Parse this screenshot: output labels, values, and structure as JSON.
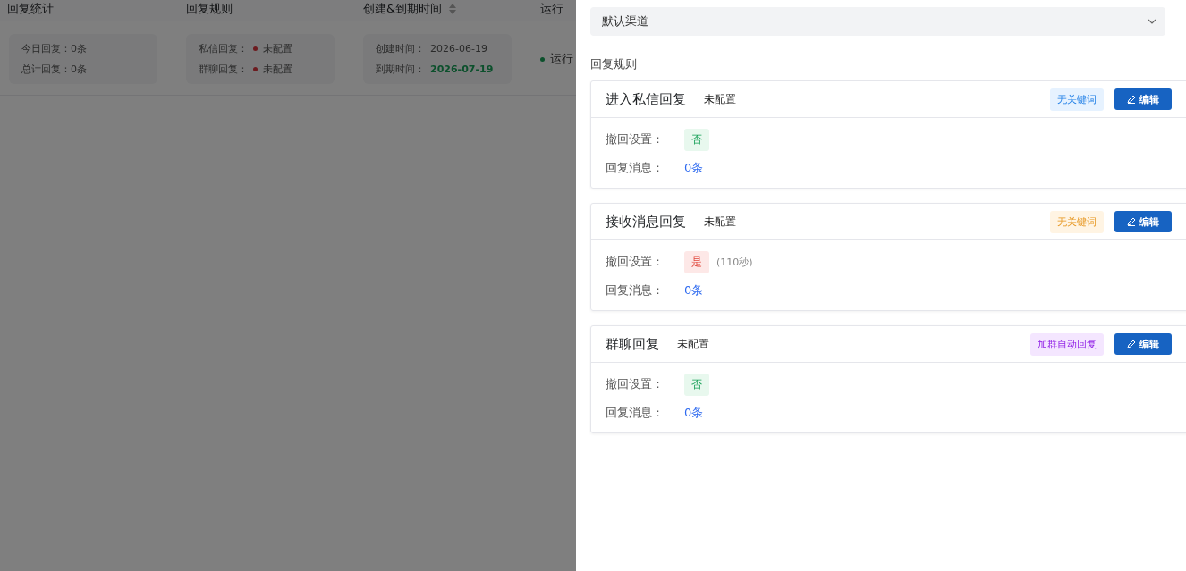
{
  "table": {
    "columns": [
      {
        "label": "回复统计",
        "sortable": false
      },
      {
        "label": "回复规则",
        "sortable": false
      },
      {
        "label": "创建&到期时间",
        "sortable": true
      },
      {
        "label": "运行",
        "sortable": false
      }
    ],
    "row": {
      "stats": [
        "今日回复：0条",
        "总计回复：0条"
      ],
      "rules": [
        {
          "label": "私信回复：",
          "status": "未配置"
        },
        {
          "label": "群聊回复：",
          "status": "未配置"
        }
      ],
      "created_label": "创建时间：",
      "created": "2026-06-19",
      "expires_label": "到期时间：",
      "expires": "2026-07-19",
      "run_status": "运行"
    }
  },
  "drawer": {
    "channel_select": {
      "value": "默认渠道"
    },
    "section_title": "回复规则",
    "rules": [
      {
        "title": "进入私信回复",
        "status": "未配置",
        "tag": {
          "label": "无关键词",
          "color": "#e6f2ff"
        },
        "edit": "编辑",
        "recall_label": "撤回设置：",
        "recall": {
          "value": "否",
          "on": false
        },
        "reply_label": "回复消息：",
        "reply_count": "0条"
      },
      {
        "title": "接收消息回复",
        "status": "未配置",
        "tag": {
          "label": "无关键词",
          "color": "#fff4e3"
        },
        "edit": "编辑",
        "recall_label": "撤回设置：",
        "recall": {
          "value": "是",
          "on": true
        },
        "recall_note": "(110秒)",
        "reply_label": "回复消息：",
        "reply_count": "0条"
      },
      {
        "title": "群聊回复",
        "status": "未配置",
        "tag": {
          "label": "加群自动回复",
          "color": "#f4e6ff"
        },
        "edit": "编辑",
        "recall_label": "撤回设置：",
        "recall": {
          "value": "否",
          "on": false
        },
        "reply_label": "回复消息：",
        "reply_count": "0条"
      }
    ]
  }
}
